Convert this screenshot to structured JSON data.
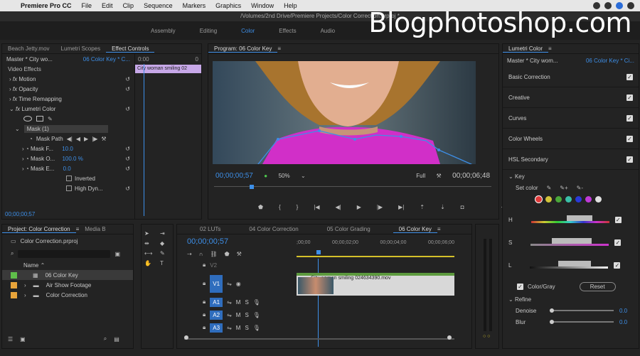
{
  "menubar": {
    "app": "Premiere Pro CC",
    "items": [
      "File",
      "Edit",
      "Clip",
      "Sequence",
      "Markers",
      "Graphics",
      "Window",
      "Help"
    ]
  },
  "titlebar": "/Volumes/2nd Drive/Premiere Projects/Color Correction.prproj *",
  "workspaces": {
    "items": [
      "Assembly",
      "Editing",
      "Color",
      "Effects",
      "Audio"
    ],
    "active": "Color"
  },
  "watermark": "Blogphotoshop.com",
  "effect_controls": {
    "tabs": [
      "Beach Jetty.mov",
      "Lumetri Scopes",
      "Effect Controls"
    ],
    "master_label": "Master * City wo...",
    "clip_label": "06 Color Key * C...",
    "timecode_start": "0:00",
    "timecode_zero": "0",
    "clip_strip": "City woman smiling 02",
    "section": "Video Effects",
    "effects": [
      "Motion",
      "Opacity",
      "Time Remapping",
      "Lumetri Color"
    ],
    "mask": "Mask (1)",
    "mask_path": "Mask Path",
    "mask_params": [
      {
        "label": "Mask F...",
        "value": "10.0"
      },
      {
        "label": "Mask O...",
        "value": "100.0 %"
      },
      {
        "label": "Mask E...",
        "value": "0.0"
      }
    ],
    "inverted": "Inverted",
    "high_dyn": "High Dyn...",
    "timecode": "00;00;00;57"
  },
  "program": {
    "title": "Program: 06 Color Key",
    "timecode": "00;00;00;57",
    "zoom": "50%",
    "quality": "Full",
    "duration": "00;00;06;48"
  },
  "lumetri": {
    "title": "Lumetri Color",
    "master_label": "Master * City wom...",
    "clip_label": "06 Color Key * Ci...",
    "sections": [
      "Basic Correction",
      "Creative",
      "Curves",
      "Color Wheels",
      "HSL Secondary"
    ],
    "key": "Key",
    "set_color": "Set color",
    "swatches": [
      "#e03a3a",
      "#d2c43a",
      "#4aa83a",
      "#3ac0a8",
      "#2a3ad8",
      "#c03ad8",
      "#e0e0e0"
    ],
    "hsl": [
      "H",
      "S",
      "L"
    ],
    "color_gray": "Color/Gray",
    "reset": "Reset",
    "refine": "Refine",
    "denoise": {
      "label": "Denoise",
      "value": "0.0"
    },
    "blur": {
      "label": "Blur",
      "value": "0.0"
    }
  },
  "project": {
    "tabs": [
      "Project: Color Correction",
      "Media B"
    ],
    "file": "Color Correction.prproj",
    "name_header": "Name",
    "items": [
      {
        "label": "06 Color Key",
        "color": "#5fbf4a"
      },
      {
        "label": "Air Show Footage",
        "color": "#e8a43a"
      },
      {
        "label": "Color Correction",
        "color": "#e8a43a"
      }
    ]
  },
  "timeline": {
    "tabs": [
      "02 LUTs",
      "04 Color Correction",
      "05 Color Grading",
      "06 Color Key"
    ],
    "timecode": "00;00;00;57",
    "ruler": [
      ";00;00",
      "00;00;02;00",
      "00;00;04;00",
      "00;00;06;00"
    ],
    "tracks": [
      "V2",
      "V1",
      "A1",
      "A2",
      "A3"
    ],
    "clip": "City woman smiling 024634390.mov"
  },
  "colors": {
    "accent": "#3d8fe8",
    "panel": "#232323",
    "clip": "#d8d8d8",
    "magenta": "#d636c8"
  }
}
